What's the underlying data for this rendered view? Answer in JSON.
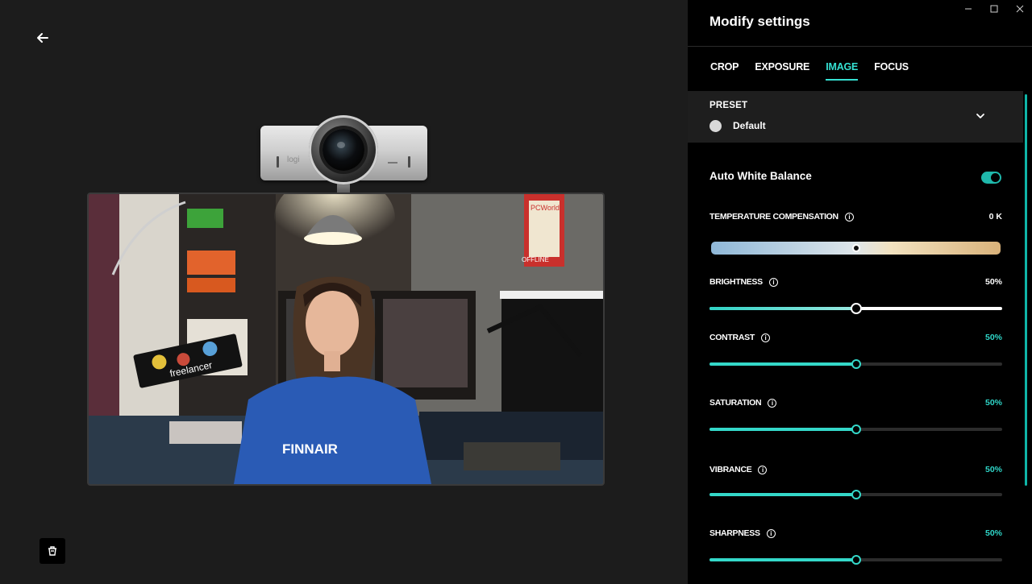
{
  "window": {
    "controls": [
      "minimize",
      "maximize",
      "close"
    ]
  },
  "panel": {
    "title": "Modify settings",
    "tabs": [
      {
        "label": "CROP",
        "active": false
      },
      {
        "label": "EXPOSURE",
        "active": false
      },
      {
        "label": "IMAGE",
        "active": true
      },
      {
        "label": "FOCUS",
        "active": false
      }
    ],
    "preset": {
      "label": "PRESET",
      "value": "Default"
    },
    "auto_white_balance": {
      "label": "Auto White Balance",
      "enabled": true
    },
    "temperature": {
      "label": "TEMPERATURE COMPENSATION",
      "value": "0 K",
      "level": 0.5
    },
    "sliders": [
      {
        "key": "brightness",
        "label": "BRIGHTNESS",
        "value": "50%",
        "level": 0.5
      },
      {
        "key": "contrast",
        "label": "CONTRAST",
        "value": "50%",
        "level": 0.5
      },
      {
        "key": "saturation",
        "label": "SATURATION",
        "value": "50%",
        "level": 0.5
      },
      {
        "key": "vibrance",
        "label": "VIBRANCE",
        "value": "50%",
        "level": 0.5
      },
      {
        "key": "sharpness",
        "label": "SHARPNESS",
        "value": "50%",
        "level": 0.5
      }
    ]
  },
  "camera": {
    "brand": "logi"
  },
  "preview": {
    "shirt_text": "FINNAIR",
    "laptop_text": "freelancer",
    "poster_text": "PCWorld",
    "sign_text": "OFFLINE"
  },
  "colors": {
    "accent": "#35e0d2",
    "panel_bg": "#000000",
    "app_bg": "#1c1c1c"
  },
  "icons": {
    "back": "arrow-left-icon",
    "tool": "cup-icon",
    "info": "info-icon",
    "chevron": "chevron-down-icon"
  }
}
